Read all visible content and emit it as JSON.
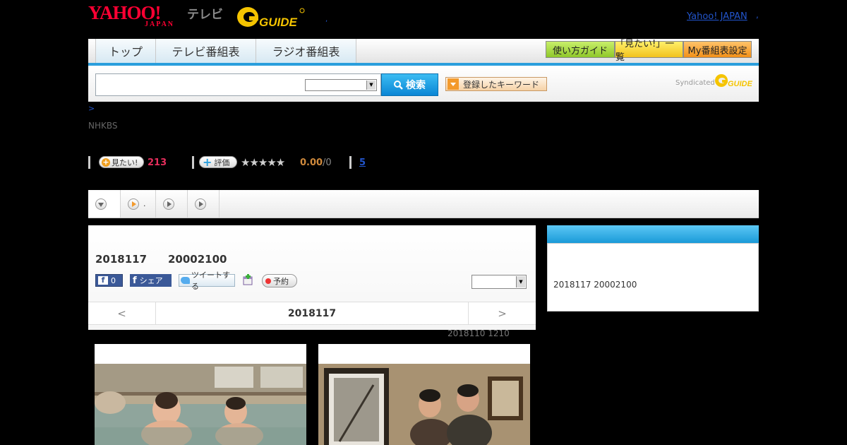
{
  "header": {
    "logo_main": "YAHOO!",
    "logo_sub": "JAPAN",
    "service_name": "テレビ",
    "gguide_logo": "GUIDE",
    "yahoo_japan_link": "Yahoo! JAPAN",
    "separator": ",",
    "dot": "."
  },
  "nav": {
    "tabs": [
      "トップ",
      "テレビ番組表",
      "ラジオ番組表"
    ],
    "right_buttons": [
      "使い方ガイド",
      "「見たい!」一覧",
      "My番組表設定"
    ]
  },
  "search": {
    "input_value": "",
    "select_value": "",
    "button_label": "検索",
    "keyword_button": "登録したキーワード",
    "syndicated_label": "Syndicated",
    "syndicated_logo": "GUIDE"
  },
  "breadcrumb": ">",
  "channel": "NHKBS",
  "stats": {
    "mitai_label": "見たい!",
    "mitai_count": "213",
    "rating_label": "評価",
    "stars": "★★★★★",
    "score": "0.00",
    "score_den": "/0",
    "extra_link": "5"
  },
  "tabs_row": {
    "items": [
      "",
      ".",
      "",
      ""
    ]
  },
  "program": {
    "date": "2018117",
    "time": "20002100",
    "fb_count": "0",
    "fb_share": "シェア",
    "tweet": "ツイートする",
    "reserve": "予約",
    "select_value": ""
  },
  "pager": {
    "prev": "<",
    "date": "2018117",
    "next": ">"
  },
  "updated": "2018110  1210",
  "side": {
    "text": "2018117  20002100"
  },
  "colors": {
    "accent_blue": "#2a9edc",
    "mitai_red": "#e62e5c",
    "score_orange": "#d08a3c"
  }
}
